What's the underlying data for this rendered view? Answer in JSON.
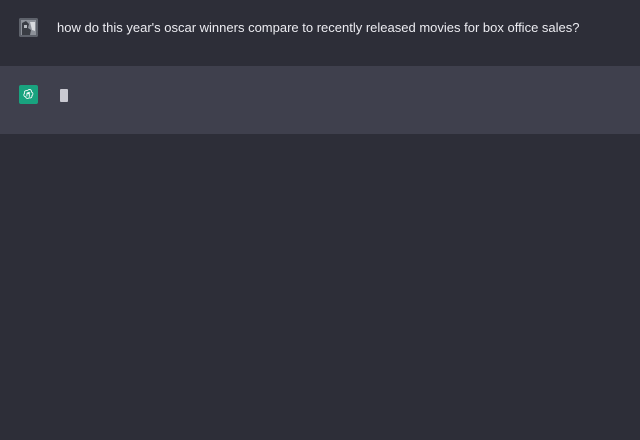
{
  "conversation": {
    "user_message": {
      "avatar_icon": "user-photo-icon",
      "text": "how do this year's oscar winners compare to recently released movies for box office sales?"
    },
    "assistant_message": {
      "avatar_icon": "openai-logo-icon",
      "text": ""
    }
  },
  "colors": {
    "background": "#2d2e38",
    "assistant_row": "#3f404d",
    "assistant_avatar": "#19a37f",
    "text": "#ececf1"
  }
}
